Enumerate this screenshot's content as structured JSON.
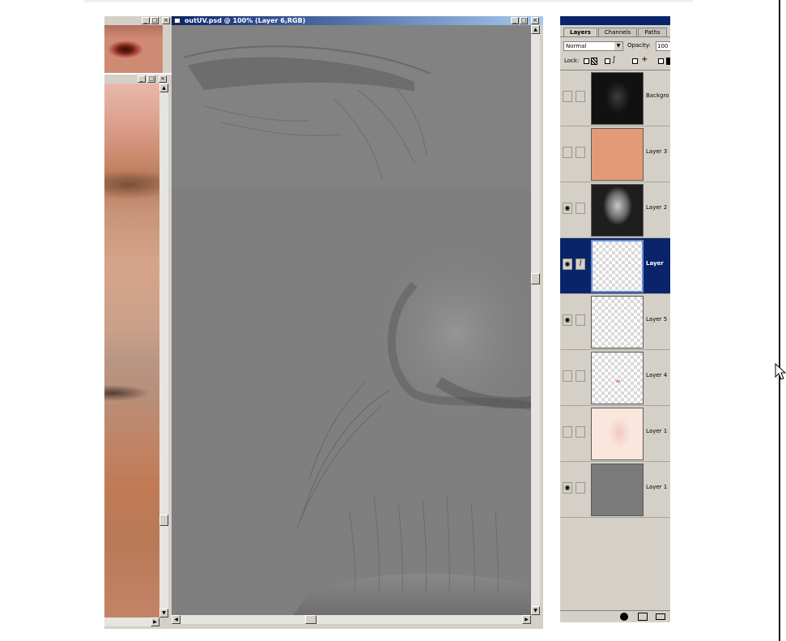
{
  "canvas_window": {
    "title": "outUV.psd @ 100% (Layer 6,RGB)"
  },
  "layers_palette": {
    "tabs": [
      {
        "label": "Layers"
      },
      {
        "label": "Channels"
      },
      {
        "label": "Paths"
      }
    ],
    "blend_mode": "Normal",
    "opacity_label": "Opacity:",
    "opacity_value": "100",
    "lock_label": "Lock:",
    "layers": [
      {
        "name": "Backgro",
        "visible": false,
        "thumb": "dark-texture"
      },
      {
        "name": "Layer 3",
        "visible": false,
        "thumb": "skin-color"
      },
      {
        "name": "Layer 2",
        "visible": true,
        "thumb": "head-render"
      },
      {
        "name": "Layer",
        "visible": true,
        "thumb": "transparent",
        "selected": true
      },
      {
        "name": "Layer 5",
        "visible": true,
        "thumb": "transparent"
      },
      {
        "name": "Layer 4",
        "visible": false,
        "thumb": "transparent-dot"
      },
      {
        "name": "Layer 1",
        "visible": false,
        "thumb": "pink-face"
      },
      {
        "name": "Layer 1",
        "visible": true,
        "thumb": "gray"
      }
    ]
  },
  "colors": {
    "title_active_start": "#0a246a",
    "selection": "#0a246a",
    "skin_swatch": "#e49a76",
    "canvas_gray": "#7a7a7a",
    "chrome": "#d4d0c8"
  }
}
